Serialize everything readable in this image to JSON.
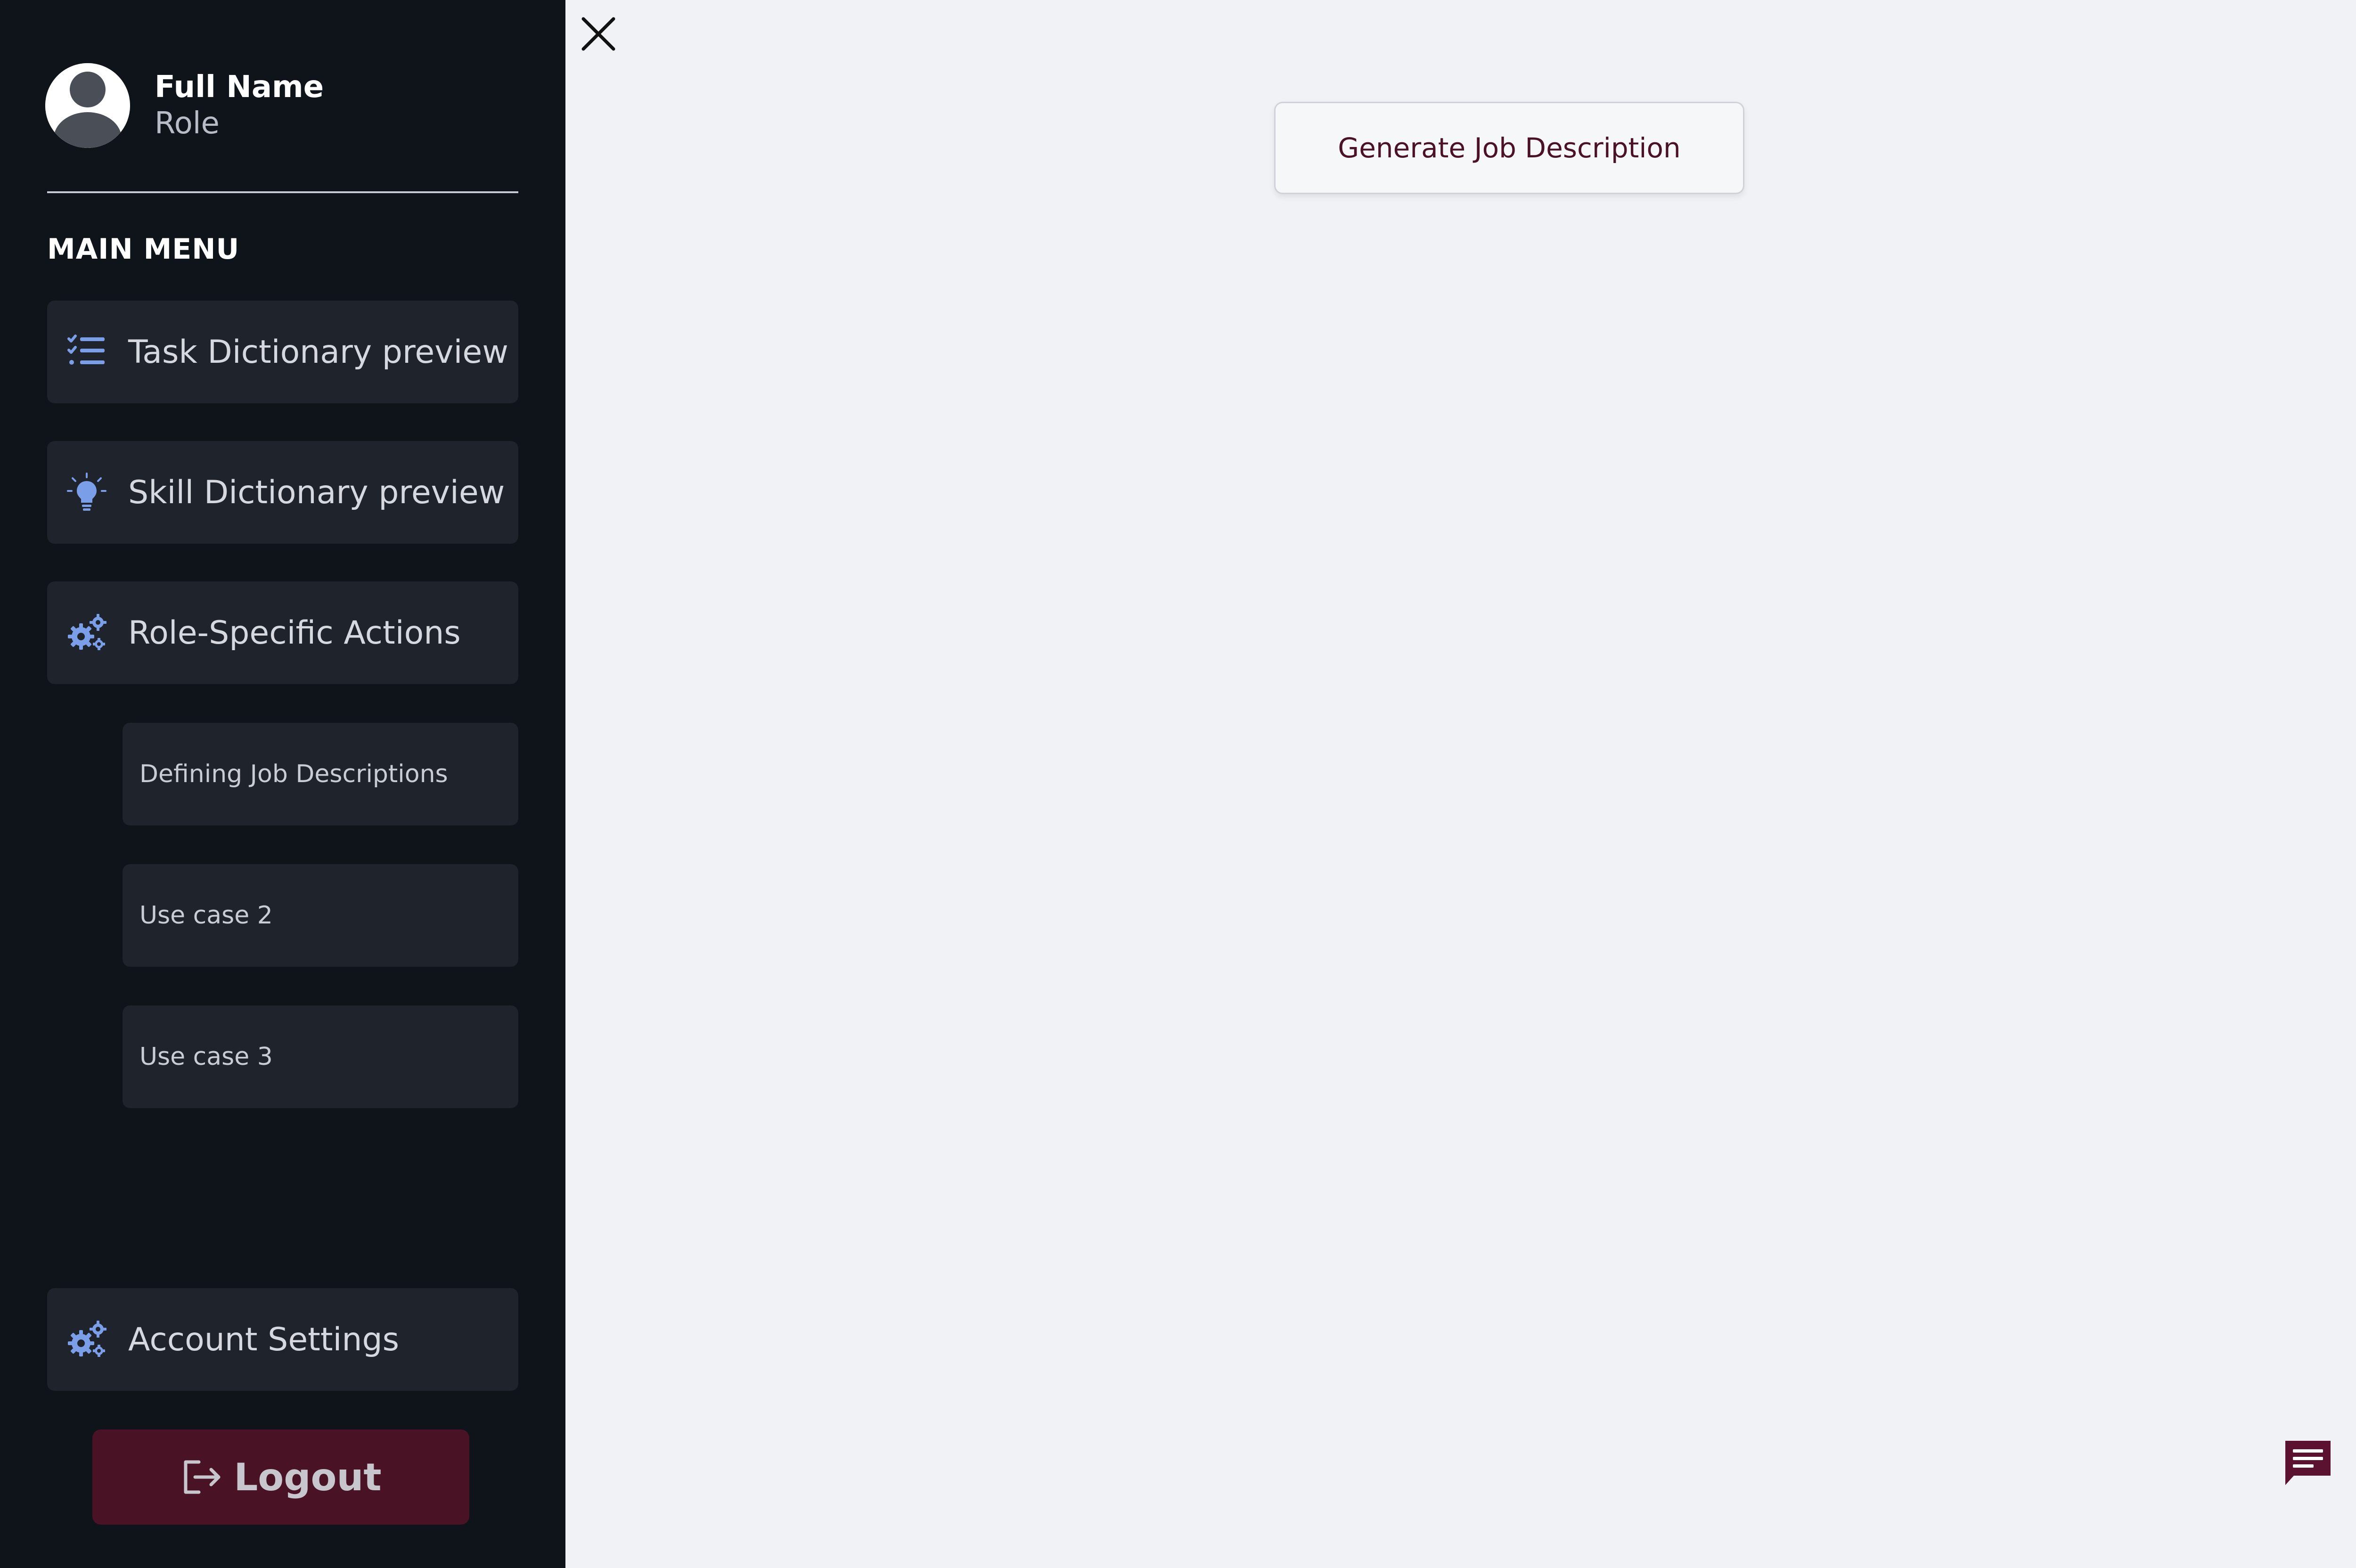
{
  "profile": {
    "name": "Full Name",
    "role": "Role"
  },
  "sidebar": {
    "heading": "MAIN MENU",
    "items": [
      {
        "label": "Task Dictionary preview",
        "icon": "task-list-icon"
      },
      {
        "label": "Skill Dictionary preview",
        "icon": "lightbulb-icon"
      },
      {
        "label": "Role-Specific Actions",
        "icon": "gears-icon"
      }
    ],
    "sub_items": [
      {
        "label": "Defining Job Descriptions"
      },
      {
        "label": "Use case 2"
      },
      {
        "label": "Use case 3"
      }
    ],
    "account_settings": {
      "label": "Account Settings",
      "icon": "gears-icon"
    },
    "logout": {
      "label": "Logout",
      "icon": "logout-icon"
    }
  },
  "main": {
    "generate_button": {
      "label": "Generate Job Description"
    },
    "close_icon": "close-icon",
    "chat_icon": "chat-icon"
  },
  "colors": {
    "sidebar_bg": "#0f141b",
    "menu_item_bg": "#1f232b",
    "icon_accent": "#7b9ee8",
    "logout_bg": "#4a1325",
    "brand": "#5a1230",
    "main_bg": "#f1f2f5"
  }
}
